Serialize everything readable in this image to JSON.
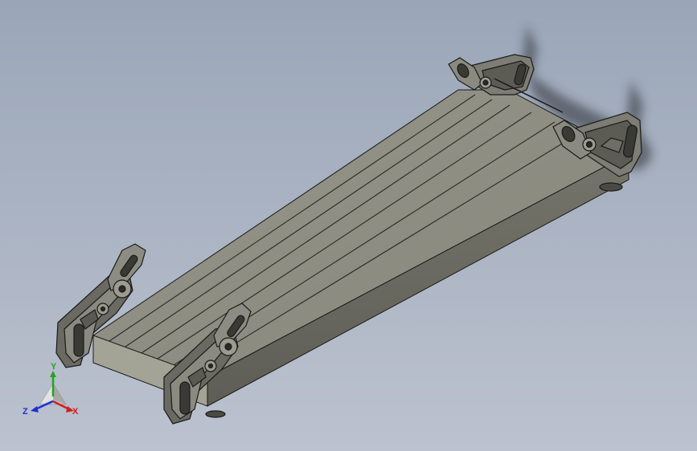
{
  "viewport": {
    "background_top": "#9aa6b8",
    "background_bottom": "#bcc2cf"
  },
  "model": {
    "deck_top_color": "#8f8f84",
    "deck_side_color": "#6b6b62",
    "deck_end_color": "#a3a397",
    "plank_count": 7,
    "bracket_color": "#7a7a72",
    "edge_color": "#1a1a1a"
  },
  "triad": {
    "x_label": "X",
    "y_label": "Y",
    "z_label": "Z",
    "x_color": "#d21e1e",
    "y_color": "#1fa51f",
    "z_color": "#2030d0"
  }
}
